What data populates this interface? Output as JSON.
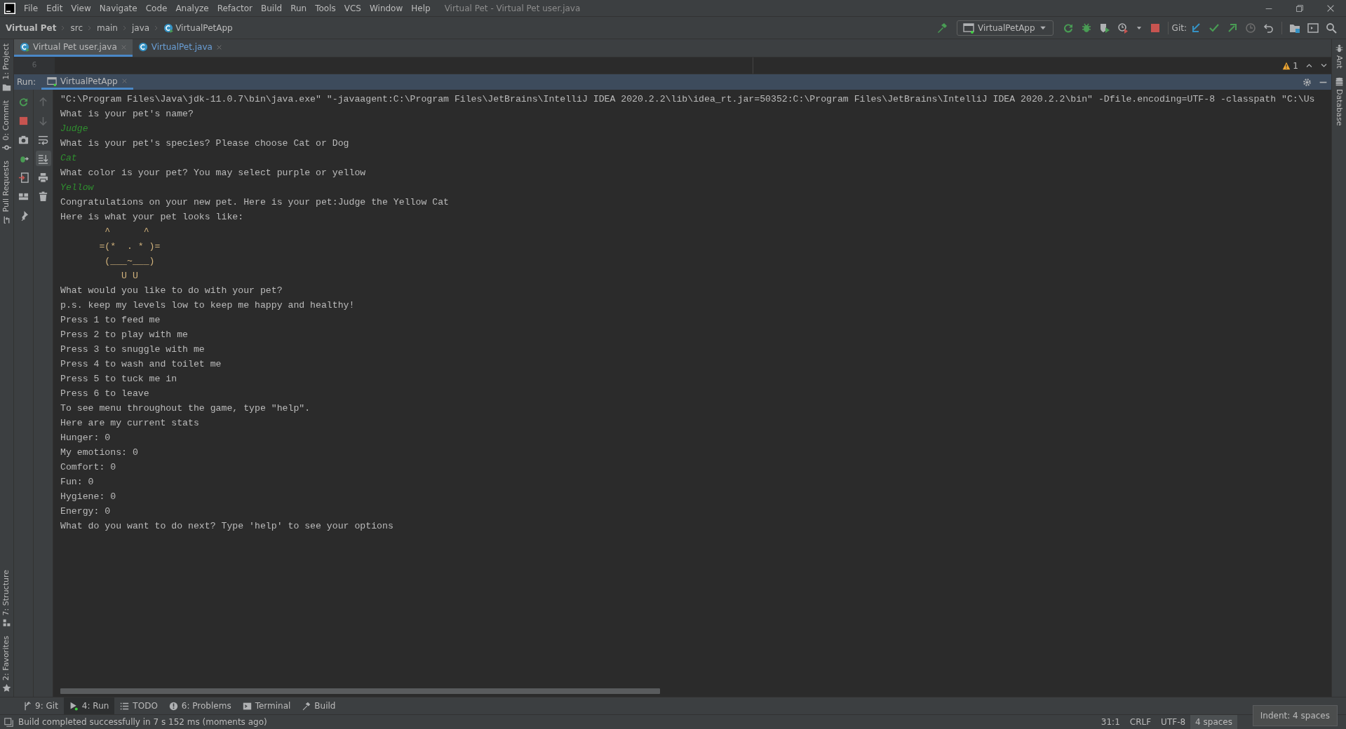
{
  "window": {
    "title": "Virtual Pet - Virtual Pet user.java"
  },
  "menu": [
    "File",
    "Edit",
    "View",
    "Navigate",
    "Code",
    "Analyze",
    "Refactor",
    "Build",
    "Run",
    "Tools",
    "VCS",
    "Window",
    "Help"
  ],
  "breadcrumbs": [
    "Virtual Pet",
    "src",
    "main",
    "java",
    "VirtualPetApp"
  ],
  "run_config": "VirtualPetApp",
  "git_label": "Git:",
  "left_tools_top": [
    "1: Project",
    "0: Commit",
    "Pull Requests"
  ],
  "left_tools_bottom": [
    "7: Structure",
    "2: Favorites"
  ],
  "right_tools": [
    "Ant",
    "Database"
  ],
  "editor_tabs": [
    {
      "label": "Virtual Pet user.java",
      "selected": true
    },
    {
      "label": "VirtualPet.java",
      "selected": false
    }
  ],
  "editor": {
    "line_number": "6",
    "warnings": "1"
  },
  "run_panel": {
    "label": "Run:",
    "tabs": [
      {
        "label": "VirtualPetApp",
        "selected": true
      }
    ]
  },
  "console_tools": [
    {
      "kind": "up",
      "disabled": true,
      "selected": false
    },
    {
      "kind": "down",
      "disabled": true,
      "selected": false
    },
    {
      "kind": "wrap",
      "disabled": false,
      "selected": false
    },
    {
      "kind": "scroll-end",
      "disabled": false,
      "selected": true
    },
    {
      "kind": "print",
      "disabled": false,
      "selected": false
    },
    {
      "kind": "trash",
      "disabled": false,
      "selected": false
    }
  ],
  "console": [
    {
      "kind": "output",
      "text": "\"C:\\Program Files\\Java\\jdk-11.0.7\\bin\\java.exe\" \"-javaagent:C:\\Program Files\\JetBrains\\IntelliJ IDEA 2020.2.2\\lib\\idea_rt.jar=50352:C:\\Program Files\\JetBrains\\IntelliJ IDEA 2020.2.2\\bin\" -Dfile.encoding=UTF-8 -classpath \"C:\\Us"
    },
    {
      "kind": "output",
      "text": "What is your pet's name?"
    },
    {
      "kind": "input",
      "text": "Judge"
    },
    {
      "kind": "output",
      "text": "What is your pet's species? Please choose Cat or Dog"
    },
    {
      "kind": "input",
      "text": "Cat"
    },
    {
      "kind": "output",
      "text": "What color is your pet? You may select purple or yellow"
    },
    {
      "kind": "input",
      "text": "Yellow"
    },
    {
      "kind": "output",
      "text": "Congratulations on your new pet. Here is your pet:Judge the Yellow Cat"
    },
    {
      "kind": "output",
      "text": "Here is what your pet looks like:"
    },
    {
      "kind": "art",
      "text": "        ^      ^"
    },
    {
      "kind": "art",
      "text": "       =(*  . * )="
    },
    {
      "kind": "art",
      "text": "        (___~___)"
    },
    {
      "kind": "art",
      "text": "           U U"
    },
    {
      "kind": "output",
      "text": "What would you like to do with your pet?"
    },
    {
      "kind": "output",
      "text": "p.s. keep my levels low to keep me happy and healthy!"
    },
    {
      "kind": "output",
      "text": "Press 1 to feed me"
    },
    {
      "kind": "output",
      "text": "Press 2 to play with me"
    },
    {
      "kind": "output",
      "text": "Press 3 to snuggle with me"
    },
    {
      "kind": "output",
      "text": "Press 4 to wash and toilet me"
    },
    {
      "kind": "output",
      "text": "Press 5 to tuck me in"
    },
    {
      "kind": "output",
      "text": "Press 6 to leave"
    },
    {
      "kind": "output",
      "text": "To see menu throughout the game, type \"help\"."
    },
    {
      "kind": "output",
      "text": "Here are my current stats"
    },
    {
      "kind": "output",
      "text": "Hunger: 0"
    },
    {
      "kind": "output",
      "text": "My emotions: 0"
    },
    {
      "kind": "output",
      "text": "Comfort: 0"
    },
    {
      "kind": "output",
      "text": "Fun: 0"
    },
    {
      "kind": "output",
      "text": "Hygiene: 0"
    },
    {
      "kind": "output",
      "text": "Energy: 0"
    },
    {
      "kind": "output",
      "text": "What do you want to do next? Type 'help' to see your options"
    }
  ],
  "tool_tabs": [
    {
      "kind": "git",
      "label": "9: Git",
      "selected": false
    },
    {
      "kind": "run",
      "label": "4: Run",
      "selected": true
    },
    {
      "kind": "todo",
      "label": "TODO",
      "selected": false
    },
    {
      "kind": "problems",
      "label": "6: Problems",
      "selected": false
    },
    {
      "kind": "terminal",
      "label": "Terminal",
      "selected": false
    },
    {
      "kind": "build",
      "label": "Build",
      "selected": false
    }
  ],
  "status_bar": {
    "message": "Build completed successfully in 7 s 152 ms (moments ago)",
    "items": [
      "31:1",
      "CRLF",
      "UTF-8",
      "4 spaces"
    ],
    "tooltip": "Indent: 4 spaces"
  }
}
